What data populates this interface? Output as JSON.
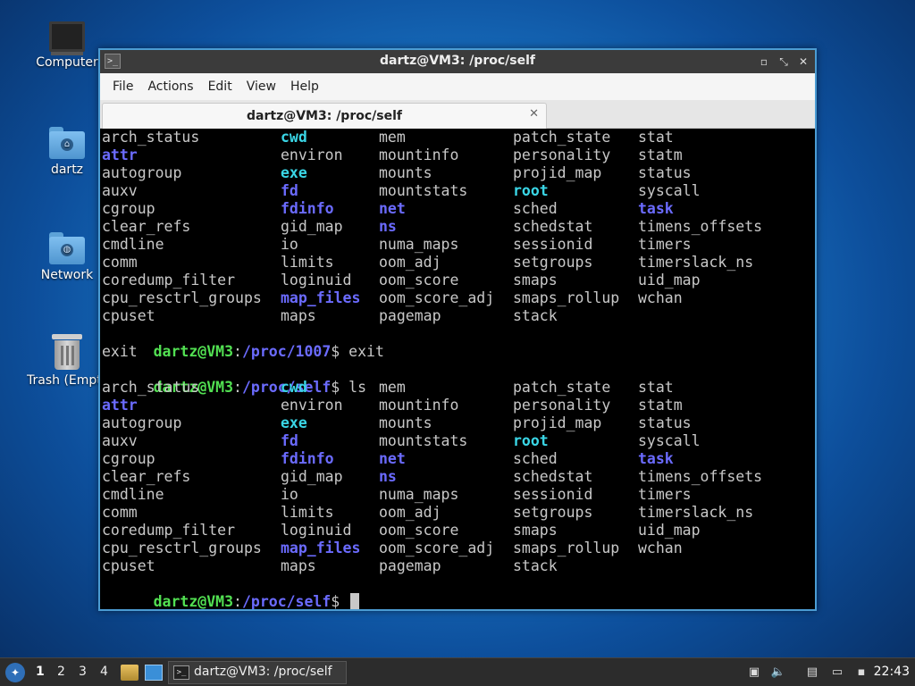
{
  "desktop": {
    "icons": [
      {
        "label": "Computer"
      },
      {
        "label": "dartz"
      },
      {
        "label": "Network"
      },
      {
        "label": "Trash (Empty)"
      }
    ]
  },
  "window": {
    "title": "dartz@VM3: /proc/self",
    "controls": {
      "minimize": "▫",
      "maximize": "⤡",
      "close": "✕"
    },
    "menu": [
      "File",
      "Actions",
      "Edit",
      "View",
      "Help"
    ],
    "tab": {
      "label": "dartz@VM3: /proc/self",
      "close": "✕"
    }
  },
  "terminal": {
    "listing1": [
      [
        "arch_status",
        "cwd",
        "mem",
        "patch_state",
        "stat"
      ],
      [
        "attr",
        "environ",
        "mountinfo",
        "personality",
        "statm"
      ],
      [
        "autogroup",
        "exe",
        "mounts",
        "projid_map",
        "status"
      ],
      [
        "auxv",
        "fd",
        "mountstats",
        "root",
        "syscall"
      ],
      [
        "cgroup",
        "fdinfo",
        "net",
        "sched",
        "task"
      ],
      [
        "clear_refs",
        "gid_map",
        "ns",
        "schedstat",
        "timens_offsets"
      ],
      [
        "cmdline",
        "io",
        "numa_maps",
        "sessionid",
        "timers"
      ],
      [
        "comm",
        "limits",
        "oom_adj",
        "setgroups",
        "timerslack_ns"
      ],
      [
        "coredump_filter",
        "loginuid",
        "oom_score",
        "smaps",
        "uid_map"
      ],
      [
        "cpu_resctrl_groups",
        "map_files",
        "oom_score_adj",
        "smaps_rollup",
        "wchan"
      ],
      [
        "cpuset",
        "maps",
        "pagemap",
        "stack",
        ""
      ]
    ],
    "prompt1": {
      "userhost": "dartz@VM3",
      "sep": ":",
      "path": "/proc/1007",
      "dollar": "$",
      "cmd": " exit"
    },
    "output1": "exit",
    "prompt2": {
      "userhost": "dartz@VM3",
      "sep": ":",
      "path": "/proc/self",
      "dollar": "$",
      "cmd": " ls"
    },
    "prompt3": {
      "userhost": "dartz@VM3",
      "sep": ":",
      "path": "/proc/self",
      "dollar": "$",
      "cmd": " "
    }
  },
  "taskbar": {
    "workspaces": [
      "1",
      "2",
      "3",
      "4"
    ],
    "task_label": "dartz@VM3: /proc/self",
    "clock": "22:43"
  }
}
